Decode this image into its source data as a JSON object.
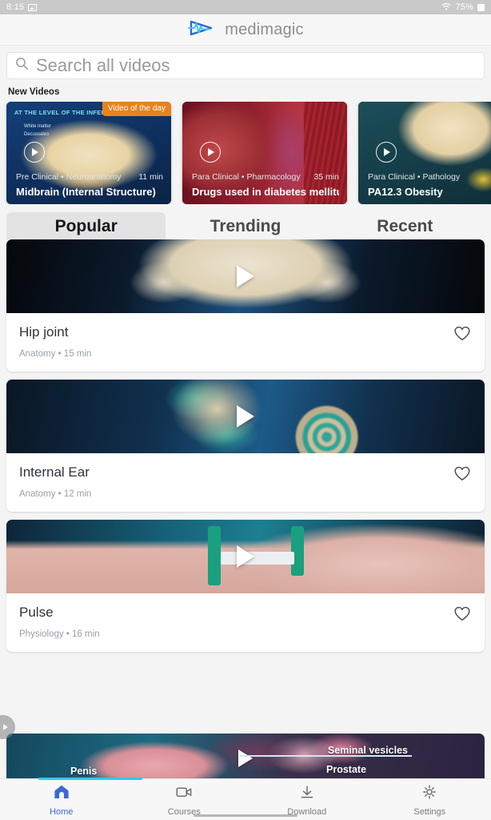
{
  "status_bar": {
    "time": "8:15",
    "image_icon": "image-icon",
    "wifi_icon": "wifi-icon",
    "battery_percent": "75%",
    "battery_icon": "battery-icon"
  },
  "header": {
    "brand_name": "medimagic",
    "logo_icon": "medimagic-pulse-arrow-logo",
    "logo_arrow_color": "#2f63d9",
    "logo_pulse_color": "#3fc8ef"
  },
  "search": {
    "icon": "search-icon",
    "placeholder": "Search all videos",
    "value": ""
  },
  "new_videos": {
    "section_title": "New Videos",
    "badge_color": "#e8821e",
    "cards": [
      {
        "badge": "Video of the day",
        "meta": "Pre Clinical • Neuroanatomy",
        "duration": "11 min",
        "title": "Midbrain (Internal Structure)",
        "overlay_heading": "AT THE LEVEL OF THE INFERIOR COLLICULUS",
        "overlay_line1": "White matter",
        "overlay_line2": "Decussates",
        "play_icon": "play-icon"
      },
      {
        "badge": "",
        "meta": "Para Clinical • Pharmacology",
        "duration": "35 min",
        "title": "Drugs used in diabetes mellitus II",
        "overlay_heading": "",
        "overlay_line1": "",
        "overlay_line2": "",
        "play_icon": "play-icon"
      },
      {
        "badge": "",
        "meta": "Para Clinical • Pathology",
        "duration": "",
        "title": "PA12.3 Obesity",
        "overlay_heading": "",
        "overlay_line1": "",
        "overlay_line2": "",
        "play_icon": "play-icon"
      }
    ]
  },
  "tabs": {
    "active_index": 0,
    "items": [
      {
        "label": "Popular"
      },
      {
        "label": "Trending"
      },
      {
        "label": "Recent"
      }
    ]
  },
  "video_list": [
    {
      "title": "Hip joint",
      "subject": "Anatomy",
      "duration": "15 min",
      "subtitle": "Anatomy • 15 min",
      "favorite_icon": "heart-outline-icon",
      "play_icon": "play-icon"
    },
    {
      "title": "Internal Ear",
      "subject": "Anatomy",
      "duration": "12 min",
      "subtitle": "Anatomy • 12 min",
      "favorite_icon": "heart-outline-icon",
      "play_icon": "play-icon"
    },
    {
      "title": "Pulse",
      "subject": "Physiology",
      "duration": "16 min",
      "subtitle": "Physiology • 16 min",
      "favorite_icon": "heart-outline-icon",
      "play_icon": "play-icon"
    }
  ],
  "partial_card": {
    "label_seminal_vesicles": "Seminal vesicles",
    "label_penis": "Penis",
    "label_prostate": "Prostate",
    "play_icon": "play-icon"
  },
  "side_handle": {
    "icon": "chevron-right-icon"
  },
  "bottom_nav": {
    "active_color": "#3b68d4",
    "inactive_color": "#7b7b7b",
    "items": [
      {
        "label": "Home",
        "icon": "home-icon",
        "active": true
      },
      {
        "label": "Courses",
        "icon": "video-camera-icon",
        "active": false
      },
      {
        "label": "Download",
        "icon": "download-icon",
        "active": false
      },
      {
        "label": "Settings",
        "icon": "gear-icon",
        "active": false
      }
    ]
  }
}
